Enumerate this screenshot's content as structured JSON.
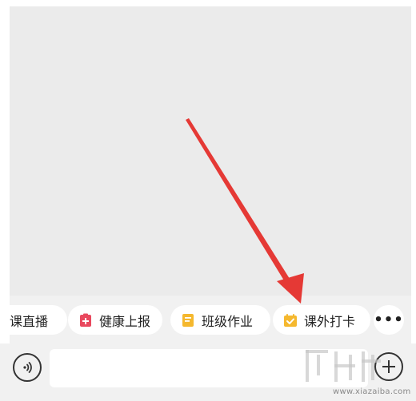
{
  "quick_actions": [
    {
      "label": "课直播",
      "icon": "live-icon"
    },
    {
      "label": "健康上报",
      "icon": "health-report-icon",
      "icon_color": "#e9485e"
    },
    {
      "label": "班级作业",
      "icon": "homework-icon",
      "icon_color": "#f5b82e"
    },
    {
      "label": "课外打卡",
      "icon": "checkin-icon",
      "icon_color": "#f5b82e"
    }
  ],
  "more_button": {
    "label": "•••",
    "icon": "more-icon"
  },
  "input_bar": {
    "voice_icon": "voice-icon",
    "text_value": "",
    "plus_icon": "plus-icon"
  },
  "annotation": {
    "type": "arrow",
    "color": "#e53935"
  },
  "watermark": {
    "url_text": "www.xiazaiba.com"
  },
  "colors": {
    "chat_background": "#ebebeb",
    "bar_background": "#f1f1f1",
    "chip_background": "#ffffff"
  }
}
